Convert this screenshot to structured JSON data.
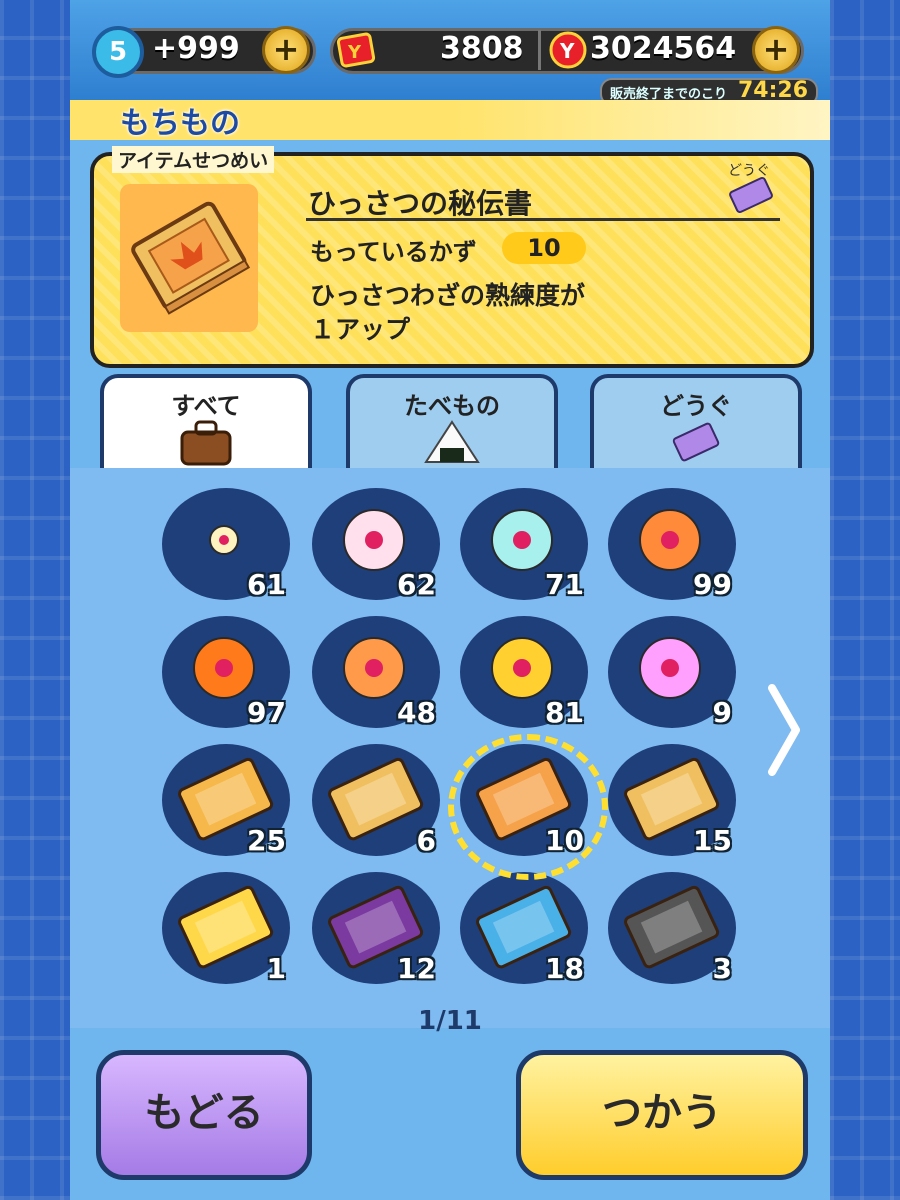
{
  "header": {
    "level_badge": "5",
    "stamina_value": "+999",
    "ticket_value": "3808",
    "money_value": "3024564",
    "plus_label": "+",
    "timer_label": "販売終了までのこり",
    "timer_value": "74:26"
  },
  "title": "もちもの",
  "description": {
    "section_label": "アイテムせつめい",
    "item_name": "ひっさつの秘伝書",
    "category_tag": "どうぐ",
    "count_label": "もっているかず",
    "count_value": "10",
    "effect_line1": "ひっさつわざの熟練度が",
    "effect_line2": "１アップ"
  },
  "tabs": [
    {
      "label": "すべて",
      "icon": "bag-icon",
      "active": true
    },
    {
      "label": "たべもの",
      "icon": "onigiri-icon",
      "active": false
    },
    {
      "label": "どうぐ",
      "icon": "ticket-icon",
      "active": false
    }
  ],
  "items": [
    {
      "icon": "small-orb-white-icon",
      "count": "61"
    },
    {
      "icon": "orb-pink-icon",
      "count": "62"
    },
    {
      "icon": "orb-cyan-icon",
      "count": "71"
    },
    {
      "icon": "orb-orange-icon",
      "count": "99"
    },
    {
      "icon": "flame-orb-icon",
      "count": "97"
    },
    {
      "icon": "orb-shrine-icon",
      "count": "48"
    },
    {
      "icon": "orb-gold-frame-icon",
      "count": "81"
    },
    {
      "icon": "rainbow-orb-gold-icon",
      "count": "9"
    },
    {
      "icon": "scroll-book-small-icon",
      "count": "25"
    },
    {
      "icon": "scroll-book-icon",
      "count": "6"
    },
    {
      "icon": "hiden-book-icon",
      "count": "10",
      "selected": true
    },
    {
      "icon": "bound-book-green-icon",
      "count": "15"
    },
    {
      "icon": "golden-book-icon",
      "count": "1"
    },
    {
      "icon": "purple-book-icon",
      "count": "12"
    },
    {
      "icon": "blue-book-icon",
      "count": "18"
    },
    {
      "icon": "stone-tablet-icon",
      "count": "3"
    }
  ],
  "pager": "1/11",
  "buttons": {
    "back_label": "もどる",
    "use_label": "つかう"
  },
  "colors": {
    "accent_yellow": "#ffe05a",
    "frame_blue": "#2a5fbe",
    "cell_dark": "#1e3f7a",
    "back_button": "#b58ae8",
    "use_button": "#ffd43a"
  }
}
